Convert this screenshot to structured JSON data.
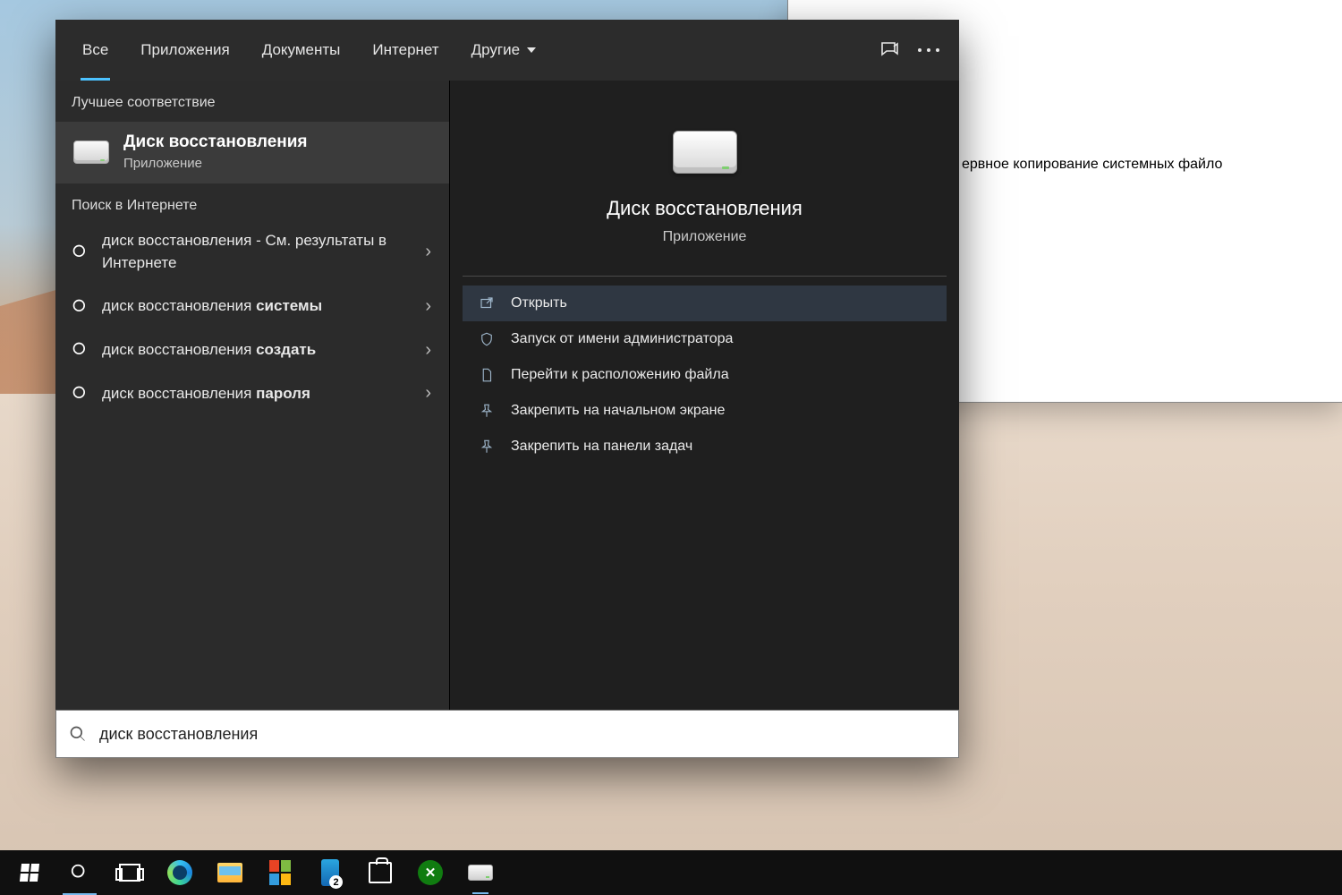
{
  "tabs": {
    "all": "Все",
    "apps": "Приложения",
    "docs": "Документы",
    "internet": "Интернет",
    "other": "Другие"
  },
  "left": {
    "best_match_header": "Лучшее соответствие",
    "best": {
      "title": "Диск восстановления",
      "subtitle": "Приложение"
    },
    "web_header": "Поиск в Интернете",
    "suggestions": [
      {
        "prefix": "диск восстановления",
        "suffix": " - См. результаты в Интернете",
        "bold": ""
      },
      {
        "prefix": "диск восстановления ",
        "bold": "системы",
        "suffix": ""
      },
      {
        "prefix": "диск восстановления ",
        "bold": "создать",
        "suffix": ""
      },
      {
        "prefix": "диск восстановления ",
        "bold": "пароля",
        "suffix": ""
      }
    ]
  },
  "preview": {
    "title": "Диск восстановления",
    "subtitle": "Приложение",
    "actions": {
      "open": "Открыть",
      "admin": "Запуск от имени администратора",
      "location": "Перейти к расположению файла",
      "pin_start": "Закрепить на начальном экране",
      "pin_taskbar": "Закрепить на панели задач"
    }
  },
  "search_value": "диск восстановления",
  "behind_text": "ервное копирование системных файло",
  "taskbar": {
    "badge": "2"
  }
}
